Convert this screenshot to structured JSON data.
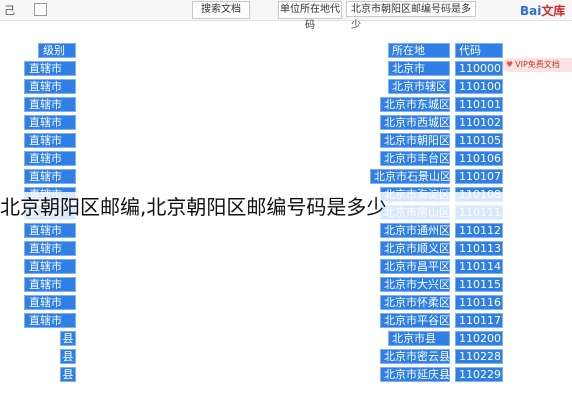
{
  "toolbar": {
    "left_text": "己",
    "button_primary": "搜索文档",
    "button_secondary": "单位所在地代码",
    "input_value": "北京市朝阳区邮编号码是多少",
    "logo_left": "Bai",
    "logo_right": "文库"
  },
  "vip_label": "VIP免费文档",
  "table": {
    "header": {
      "code": "代码",
      "name": "所在地",
      "level": "级别"
    },
    "rows": [
      {
        "code": "110000",
        "name": "北京市",
        "level": "直辖市"
      },
      {
        "code": "110100",
        "name": "北京市辖区",
        "level": "直辖市"
      },
      {
        "code": "110101",
        "name": "北京市东城区",
        "level": "直辖市"
      },
      {
        "code": "110102",
        "name": "北京市西城区",
        "level": "直辖市"
      },
      {
        "code": "110105",
        "name": "北京市朝阳区",
        "level": "直辖市"
      },
      {
        "code": "110106",
        "name": "北京市丰台区",
        "level": "直辖市"
      },
      {
        "code": "110107",
        "name": "北京市石景山区",
        "level": "直辖市"
      },
      {
        "code": "110108",
        "name": "北京市海淀区",
        "level": "直辖市"
      },
      {
        "code": "110111",
        "name": "北京市房山区",
        "level": "直辖市"
      },
      {
        "code": "110112",
        "name": "北京市通州区",
        "level": "直辖市"
      },
      {
        "code": "110113",
        "name": "北京市顺义区",
        "level": "直辖市"
      },
      {
        "code": "110114",
        "name": "北京市昌平区",
        "level": "直辖市"
      },
      {
        "code": "110115",
        "name": "北京市大兴区",
        "level": "直辖市"
      },
      {
        "code": "110116",
        "name": "北京市怀柔区",
        "level": "直辖市"
      },
      {
        "code": "110117",
        "name": "北京市平谷区",
        "level": "直辖市"
      },
      {
        "code": "110200",
        "name": "北京市县",
        "level": "县"
      },
      {
        "code": "110228",
        "name": "北京市密云县",
        "level": "县"
      },
      {
        "code": "110229",
        "name": "北京市延庆县",
        "level": "县"
      }
    ]
  },
  "headline": "北京朝阳区邮编,北京朝阳区邮编号码是多少",
  "colors": {
    "cell_bg": "#2f7fe6",
    "cell_border": "#7fb0f0",
    "vip_bg": "#fbe3e3"
  }
}
